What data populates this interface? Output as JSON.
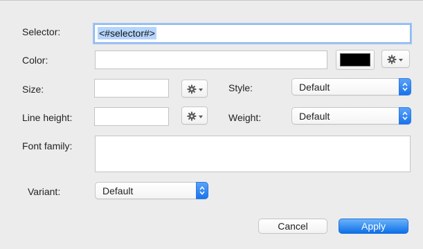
{
  "labels": {
    "selector": "Selector:",
    "color": "Color:",
    "size": "Size:",
    "style": "Style:",
    "line_height": "Line height:",
    "weight": "Weight:",
    "font_family": "Font family:",
    "variant": "Variant:"
  },
  "fields": {
    "selector_value": "<#selector#>",
    "color_value": "",
    "size_value": "",
    "line_height_value": "",
    "font_family_value": ""
  },
  "swatch": {
    "color": "#000000"
  },
  "popups": {
    "style": "Default",
    "weight": "Default",
    "variant": "Default"
  },
  "buttons": {
    "cancel": "Cancel",
    "apply": "Apply"
  },
  "icons": {
    "gear": "gear-icon",
    "popup_arrows": "up-down-chevrons-icon"
  },
  "colors": {
    "accent": "#1a73e8",
    "selection": "#b5d5fd",
    "focus_ring": "#9cc3f5"
  }
}
